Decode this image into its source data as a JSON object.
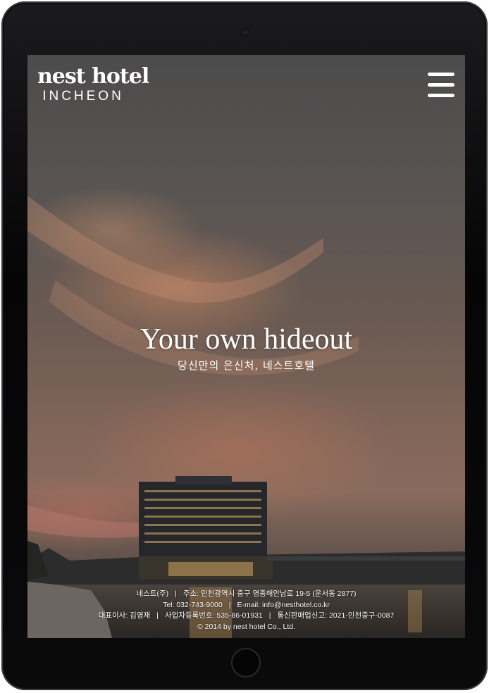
{
  "logo": {
    "main": "nest hotel",
    "sub": "INCHEON"
  },
  "menu": {
    "icon": "hamburger-menu-icon"
  },
  "hero": {
    "title": "Your own hideout",
    "subtitle": "당신만의 은신처, 네스트호텔"
  },
  "footer": {
    "company": "네스트(주)",
    "address": "주소: 인천광역시 중구 영종해안남로 19-5 (운서동 2877)",
    "tel": "Tel: 032-743-9000",
    "email": "E-mail: info@nesthotel.co.kr",
    "ceo": "대표이사: 김영재",
    "business_no": "사업자등록번호: 535-86-01931",
    "mail_order_no": "통신판매업신고: 2021-인천중구-0087",
    "copyright": "© 2014 by nest hotel Co., Ltd.",
    "separator": "|"
  },
  "colors": {
    "text": "#ffffff",
    "device": "#0a0a0b"
  }
}
